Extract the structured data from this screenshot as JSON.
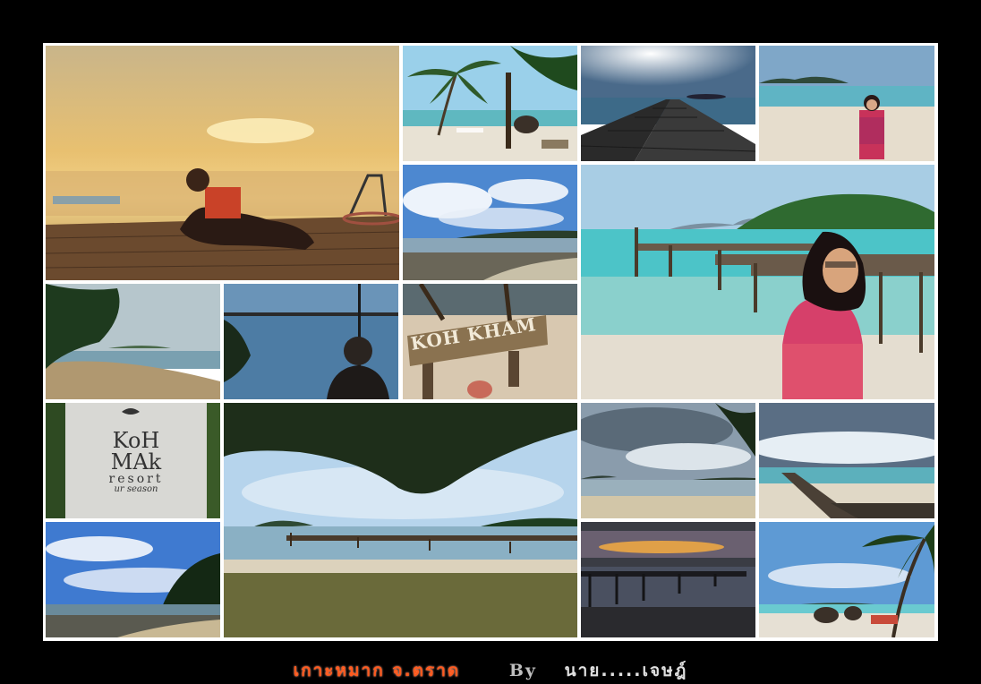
{
  "caption": {
    "title": "เกาะหมาก จ.ตราด",
    "by": "By",
    "author": "นาย.....เจษฎ์"
  },
  "signs": {
    "koh_kham": "KOH KHAM",
    "resort_line1": "KoH",
    "resort_line2": "MAk",
    "resort_line3": "resort",
    "resort_line4": "ur season"
  },
  "colors": {
    "background": "#000000",
    "border": "#ffffff",
    "caption_title": "#ff5a1e",
    "caption_by": "#bfbfbf"
  }
}
